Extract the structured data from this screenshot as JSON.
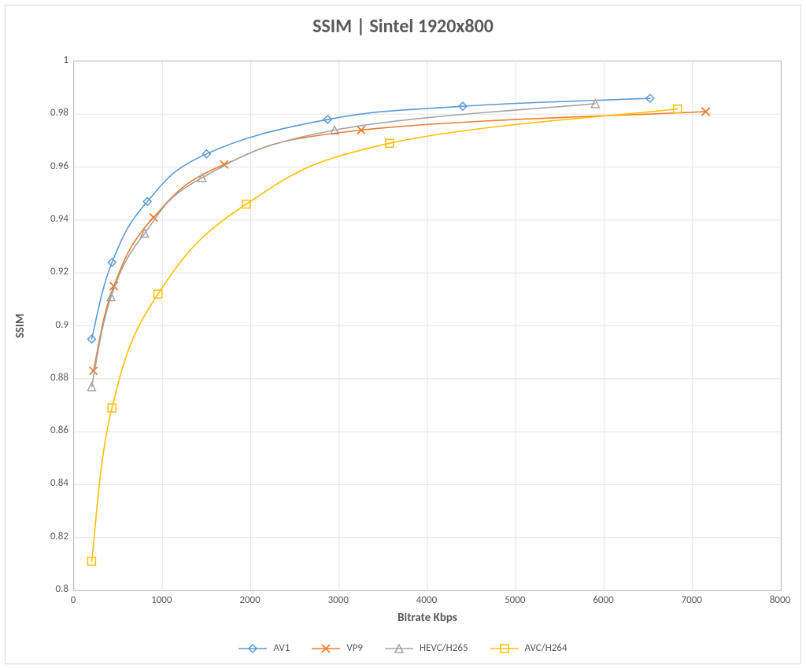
{
  "chart_data": {
    "type": "line",
    "title": "SSIM | Sintel 1920x800",
    "xlabel": "Bitrate Kbps",
    "ylabel": "SSIM",
    "xlim": [
      0,
      8000
    ],
    "ylim": [
      0.8,
      1.0
    ],
    "x_ticks": [
      0,
      1000,
      2000,
      3000,
      4000,
      5000,
      6000,
      7000,
      8000
    ],
    "y_ticks": [
      0.8,
      0.82,
      0.84,
      0.86,
      0.88,
      0.9,
      0.92,
      0.94,
      0.96,
      0.98,
      1.0
    ],
    "grid": true,
    "legend_position": "bottom",
    "series": [
      {
        "name": "AV1",
        "color": "#5B9BD5",
        "marker": "diamond",
        "points": [
          {
            "x": 200,
            "y": 0.895
          },
          {
            "x": 430,
            "y": 0.924
          },
          {
            "x": 830,
            "y": 0.947
          },
          {
            "x": 1500,
            "y": 0.965
          },
          {
            "x": 2870,
            "y": 0.978
          },
          {
            "x": 4400,
            "y": 0.983
          },
          {
            "x": 6520,
            "y": 0.986
          }
        ]
      },
      {
        "name": "VP9",
        "color": "#ED7D31",
        "marker": "x",
        "points": [
          {
            "x": 220,
            "y": 0.883
          },
          {
            "x": 450,
            "y": 0.915
          },
          {
            "x": 900,
            "y": 0.941
          },
          {
            "x": 1700,
            "y": 0.961
          },
          {
            "x": 3250,
            "y": 0.974
          },
          {
            "x": 7150,
            "y": 0.981
          }
        ]
      },
      {
        "name": "HEVC/H265",
        "color": "#A5A5A5",
        "marker": "triangle",
        "points": [
          {
            "x": 200,
            "y": 0.877
          },
          {
            "x": 420,
            "y": 0.911
          },
          {
            "x": 800,
            "y": 0.935
          },
          {
            "x": 1450,
            "y": 0.956
          },
          {
            "x": 2950,
            "y": 0.974
          },
          {
            "x": 5900,
            "y": 0.984
          }
        ]
      },
      {
        "name": "AVC/H264",
        "color": "#FFC000",
        "marker": "square",
        "points": [
          {
            "x": 200,
            "y": 0.811
          },
          {
            "x": 430,
            "y": 0.869
          },
          {
            "x": 950,
            "y": 0.912
          },
          {
            "x": 1950,
            "y": 0.946
          },
          {
            "x": 3570,
            "y": 0.969
          },
          {
            "x": 6830,
            "y": 0.982
          }
        ]
      }
    ]
  }
}
